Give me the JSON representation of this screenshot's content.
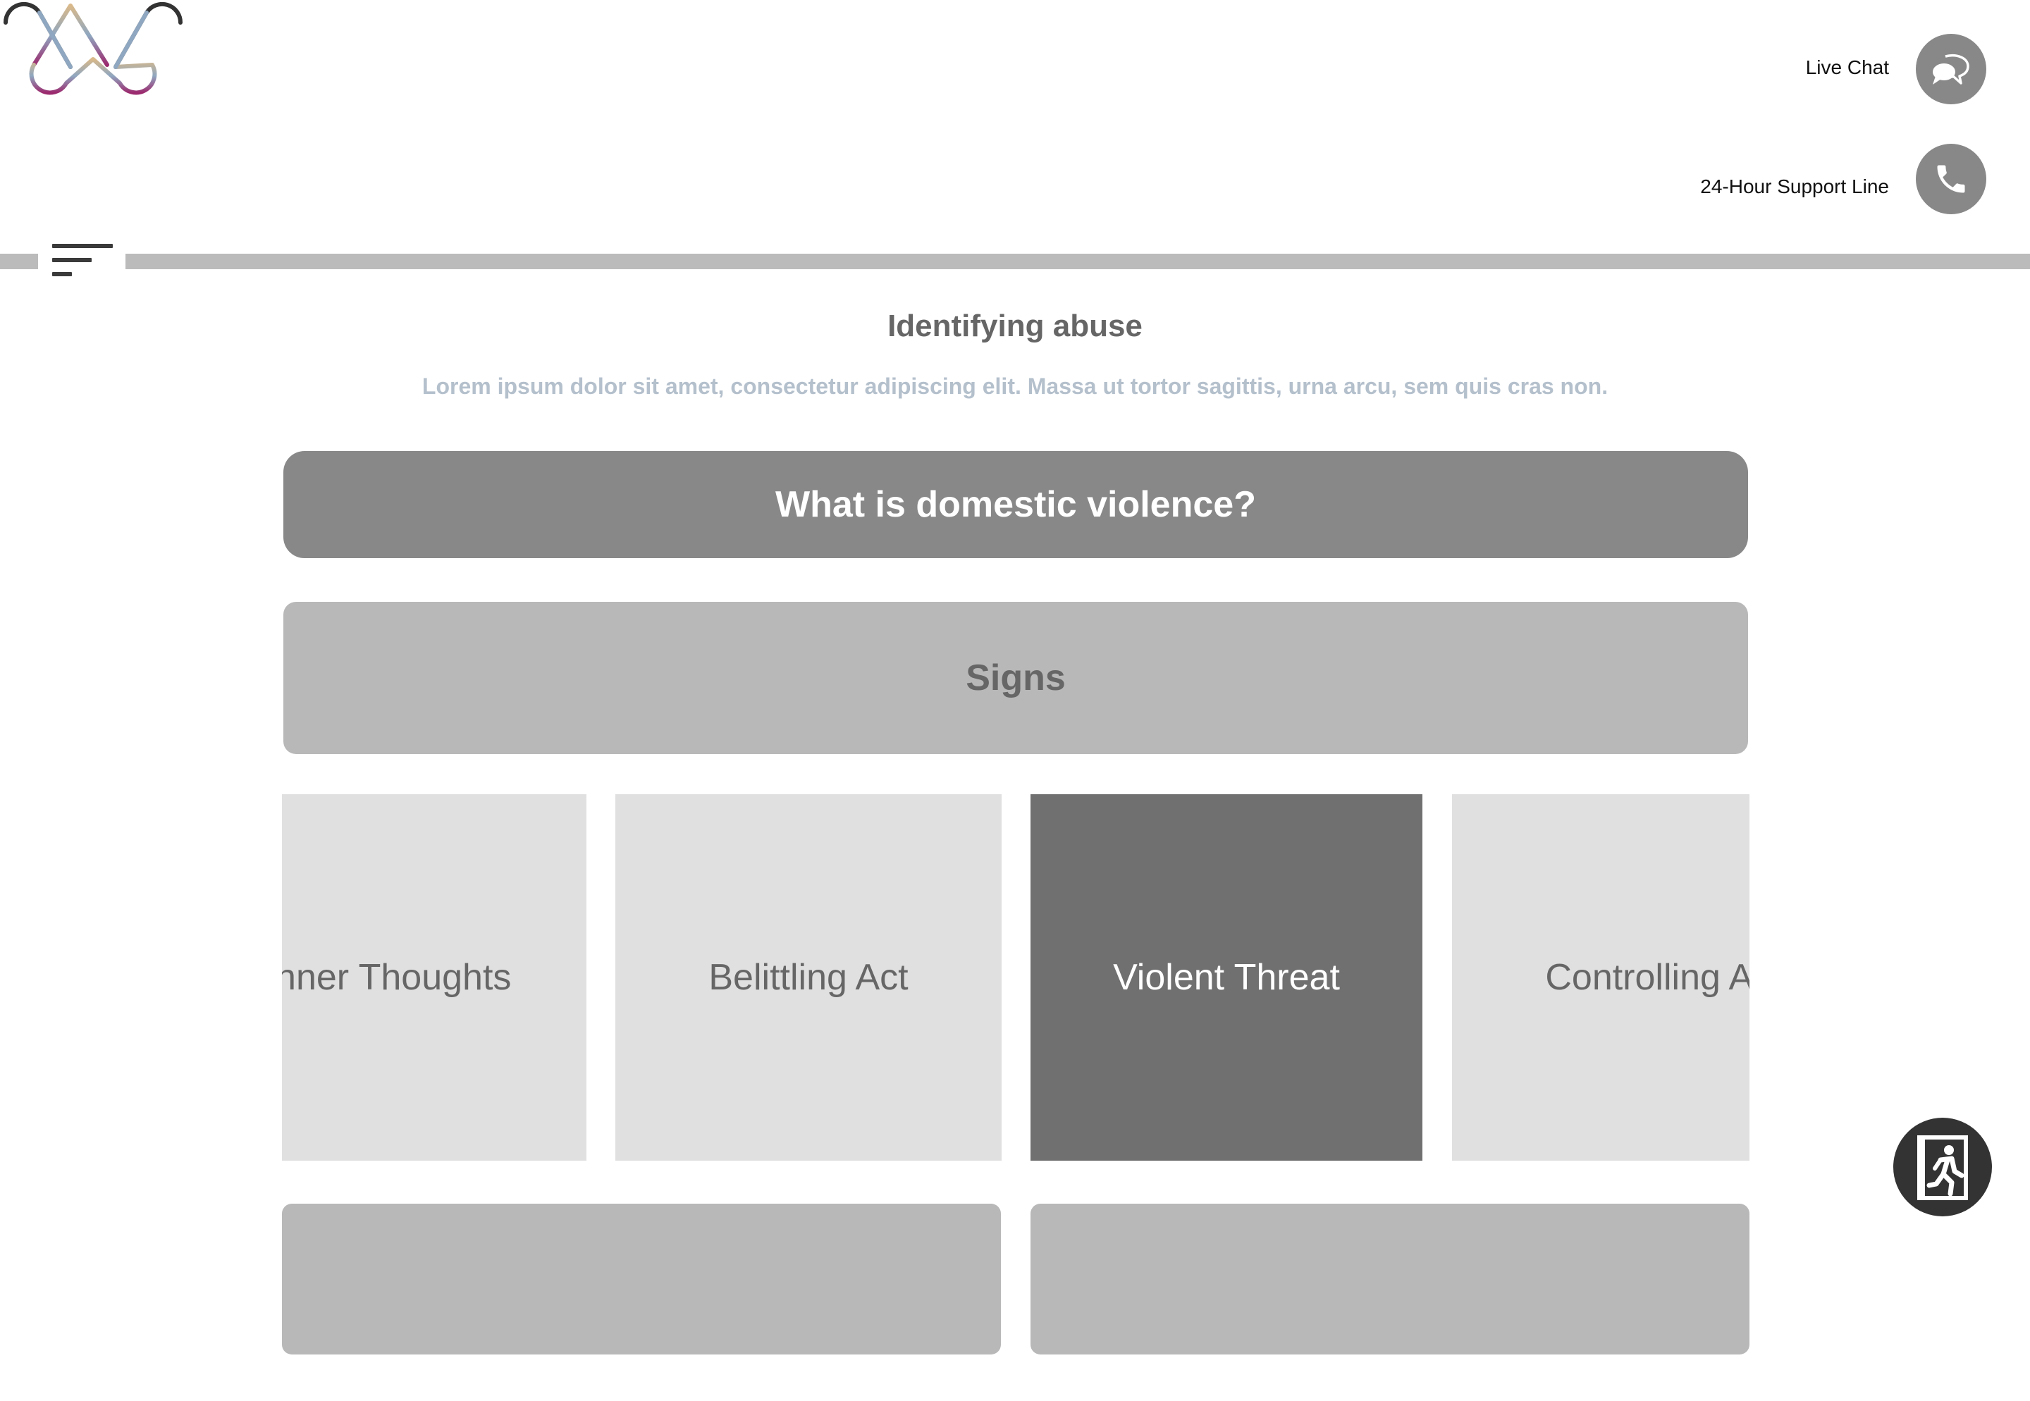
{
  "header": {
    "live_chat_label": "Live Chat",
    "support_line_label": "24-Hour Support Line",
    "icons": {
      "logo": "w-logo",
      "live_chat": "chat-bubbles-icon",
      "support_line": "phone-icon",
      "menu": "menu-lines-icon",
      "exit": "emergency-exit-icon"
    }
  },
  "main": {
    "title": "Identifying abuse",
    "subtitle": "Lorem ipsum dolor sit amet, consectetur adipiscing elit. Massa ut tortor sagittis, urna arcu, sem quis cras non.",
    "banners": {
      "what_is_dv": "What is domestic violence?",
      "signs": "Signs"
    },
    "carousel": [
      {
        "label": "Inner Thoughts",
        "active": false
      },
      {
        "label": "Belittling Act",
        "active": false
      },
      {
        "label": "Violent Threat",
        "active": true
      },
      {
        "label": "Controlling Act",
        "active": false
      }
    ]
  },
  "colors": {
    "banner_primary": "#888888",
    "banner_secondary": "#b8b8b8",
    "card_inactive": "#e0e0e0",
    "card_active": "#707070",
    "subtitle": "#b4c0cc",
    "exit_button": "#333333",
    "logo_gradient": [
      "#333333",
      "#d9b98a",
      "#8fa7c0",
      "#9b2a6e"
    ]
  }
}
